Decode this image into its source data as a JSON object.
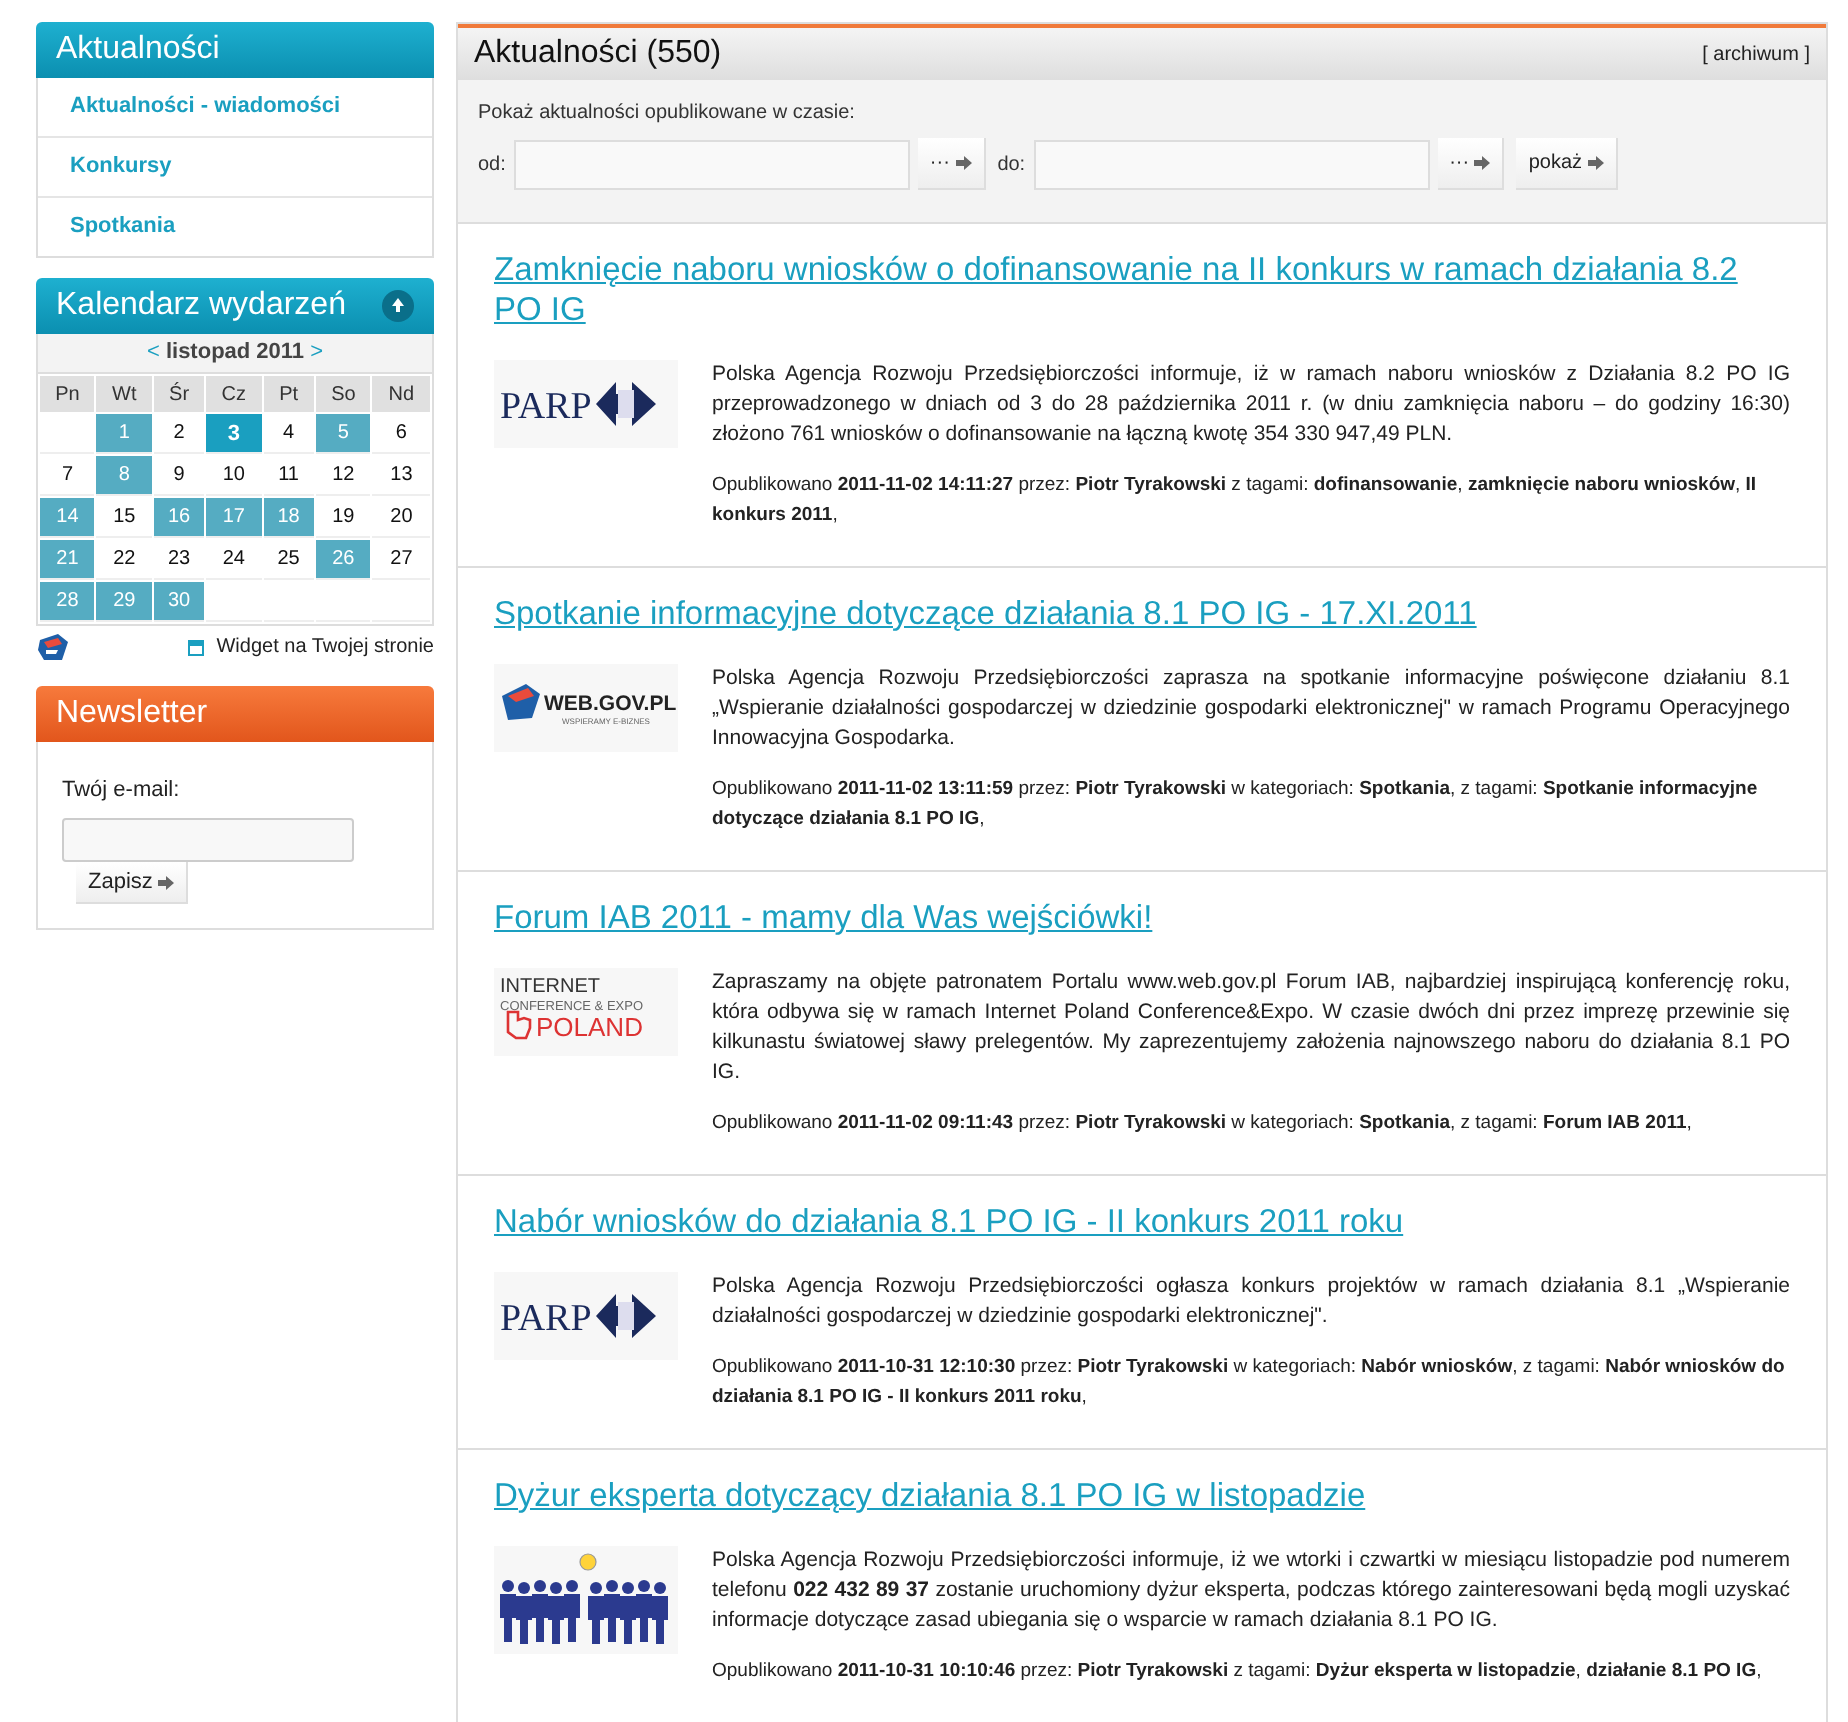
{
  "sidebar": {
    "news_menu": {
      "title": "Aktualności",
      "items": [
        {
          "label": "Aktualności - wiadomości"
        },
        {
          "label": "Konkursy"
        },
        {
          "label": "Spotkania"
        }
      ]
    },
    "calendar": {
      "title": "Kalendarz wydarzeń",
      "prev": "<",
      "month": "listopad 2011",
      "next": ">",
      "weekdays": [
        "Pn",
        "Wt",
        "Śr",
        "Cz",
        "Pt",
        "So",
        "Nd"
      ],
      "weeks": [
        [
          {
            "day": "1",
            "events": true,
            "today": false
          },
          {
            "day": "2",
            "events": false,
            "today": false
          },
          {
            "day": "3",
            "events": true,
            "today": true
          },
          {
            "day": "4",
            "events": false,
            "today": false
          },
          {
            "day": "5",
            "events": true,
            "today": false
          },
          {
            "day": "6",
            "events": false,
            "today": false
          }
        ],
        [
          {
            "day": "7",
            "events": false,
            "today": false
          },
          {
            "day": "8",
            "events": true,
            "today": false
          },
          {
            "day": "9",
            "events": false,
            "today": false
          },
          {
            "day": "10",
            "events": false,
            "today": false
          },
          {
            "day": "11",
            "events": false,
            "today": false
          },
          {
            "day": "12",
            "events": false,
            "today": false
          },
          {
            "day": "13",
            "events": false,
            "today": false
          }
        ],
        [
          {
            "day": "14",
            "events": true,
            "today": false
          },
          {
            "day": "15",
            "events": false,
            "today": false
          },
          {
            "day": "16",
            "events": true,
            "today": false
          },
          {
            "day": "17",
            "events": true,
            "today": false
          },
          {
            "day": "18",
            "events": true,
            "today": false
          },
          {
            "day": "19",
            "events": false,
            "today": false
          },
          {
            "day": "20",
            "events": false,
            "today": false
          }
        ],
        [
          {
            "day": "21",
            "events": true,
            "today": false
          },
          {
            "day": "22",
            "events": false,
            "today": false
          },
          {
            "day": "23",
            "events": false,
            "today": false
          },
          {
            "day": "24",
            "events": false,
            "today": false
          },
          {
            "day": "25",
            "events": false,
            "today": false
          },
          {
            "day": "26",
            "events": true,
            "today": false
          },
          {
            "day": "27",
            "events": false,
            "today": false
          }
        ],
        [
          {
            "day": "28",
            "events": true,
            "today": false
          },
          {
            "day": "29",
            "events": true,
            "today": false
          },
          {
            "day": "30",
            "events": true,
            "today": false
          }
        ]
      ],
      "widget_link": "Widget na Twojej stronie"
    },
    "newsletter": {
      "title": "Newsletter",
      "email_label": "Twój e-mail:",
      "button": "Zapisz"
    }
  },
  "main": {
    "title": "Aktualności (550)",
    "archive_link": "[ archiwum ]",
    "filter": {
      "caption": "Pokaż aktualności opublikowane w czasie:",
      "from_label": "od:",
      "from_picker": "···",
      "to_label": "do:",
      "to_picker": "···",
      "submit": "pokaż"
    },
    "posts": [
      {
        "title": "Zamknięcie naboru wniosków o dofinansowanie na II konkurs w ramach działania 8.2 PO IG",
        "logo": {
          "kind": "parp",
          "texts": [
            "PARP"
          ]
        },
        "body": "Polska Agencja Rozwoju Przedsiębiorczości informuje, iż w ramach naboru wniosków z Działania 8.2 PO IG przeprowadzonego w dniach od 3 do 28 października 2011 r. (w dniu zamknięcia naboru – do godziny 16:30) złożono 761 wniosków o dofinansowanie na łączną kwotę 354 330 947,49 PLN.",
        "meta": "Opublikowano **2011-11-02 14:11:27** przez: **Piotr Tyrakowski** z tagami: **dofinansowanie**, **zamknięcie naboru wniosków**, **II konkurs 2011**,"
      },
      {
        "title": "Spotkanie informacyjne dotyczące działania 8.1 PO IG - 17.XI.2011",
        "logo": {
          "kind": "webgov",
          "texts": [
            "WEB.GOV.PL",
            "WSPIERAMY E-BIZNES"
          ]
        },
        "body": "Polska Agencja Rozwoju Przedsiębiorczości zaprasza na spotkanie informacyjne poświęcone działaniu 8.1 „Wspieranie działalności gospodarczej w dziedzinie gospodarki elektronicznej\" w ramach Programu Operacyjnego Innowacyjna Gospodarka.",
        "meta": "Opublikowano **2011-11-02 13:11:59** przez: **Piotr Tyrakowski** w kategoriach: **Spotkania**, z tagami: **Spotkanie informacyjne dotyczące działania 8.1 PO IG**,"
      },
      {
        "title": "Forum IAB 2011 - mamy dla Was wejściówki!",
        "logo": {
          "kind": "iab",
          "texts": [
            "INTERNET",
            "CONFERENCE & EXPO",
            "POLAND"
          ]
        },
        "body": "Zapraszamy na objęte patronatem Portalu www.web.gov.pl Forum IAB, najbardziej inspirującą konferencję roku, która odbywa się w ramach Internet Poland Conference&Expo. W czasie dwóch dni przez imprezę przewinie się kilkunastu światowej sławy prelegentów. My zaprezentujemy założenia najnowszego naboru do działania 8.1 PO IG.",
        "meta": "Opublikowano **2011-11-02 09:11:43** przez: **Piotr Tyrakowski** w kategoriach: **Spotkania**, z tagami: **Forum IAB 2011**,"
      },
      {
        "title": "Nabór wniosków do działania 8.1 PO IG - II konkurs 2011 roku",
        "logo": {
          "kind": "parp",
          "texts": [
            "PARP"
          ]
        },
        "body": "Polska Agencja Rozwoju Przedsiębiorczości ogłasza konkurs projektów w ramach działania 8.1 „Wspieranie działalności gospodarczej w dziedzinie gospodarki elektronicznej\".",
        "meta": "Opublikowano **2011-10-31 12:10:30** przez: **Piotr Tyrakowski** w kategoriach: **Nabór wniosków**, z tagami: **Nabór wniosków do działania 8.1 PO IG - II konkurs 2011 roku**,"
      },
      {
        "title": "Dyżur eksperta dotyczący działania 8.1 PO IG w listopadzie",
        "logo": {
          "kind": "people"
        },
        "body": "Polska Agencja Rozwoju Przedsiębiorczości informuje, iż we wtorki i czwartki w miesiącu listopadzie pod numerem telefonu **022 432 89 37** zostanie uruchomiony dyżur eksperta, podczas którego zainteresowani będą mogli uzyskać informacje dotyczące zasad ubiegania się o wsparcie w ramach działania 8.1 PO IG.",
        "meta": "Opublikowano **2011-10-31 10:10:46** przez: **Piotr Tyrakowski** z tagami: **Dyżur eksperta w listopadzie**, **działanie 8.1 PO IG**,"
      }
    ]
  }
}
